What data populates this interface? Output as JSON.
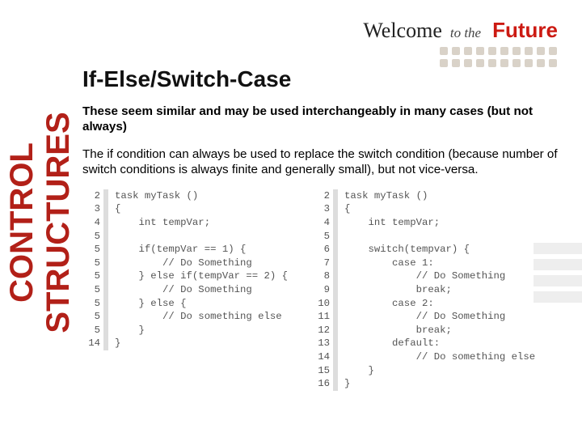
{
  "vertical_label": "CONTROL STRUCTURES",
  "header": {
    "welcome": "Welcome",
    "to_the": "to the",
    "future": "Future"
  },
  "title": "If-Else/Switch-Case",
  "para1": "These seem similar and may be used interchangeably in many cases (but not always)",
  "para2": "The if condition can always be used to replace the switch condition (because number of switch conditions is always finite and generally small), but not vice-versa.",
  "code_left": {
    "lines": [
      {
        "n": "2",
        "t": "task myTask ()"
      },
      {
        "n": "3",
        "t": "{"
      },
      {
        "n": "4",
        "t": "    int tempVar;"
      },
      {
        "n": "5",
        "t": ""
      },
      {
        "n": "5",
        "t": "    if(tempVar == 1) {"
      },
      {
        "n": "5",
        "t": "        // Do Something"
      },
      {
        "n": "5",
        "t": "    } else if(tempVar == 2) {"
      },
      {
        "n": "5",
        "t": "        // Do Something"
      },
      {
        "n": "5",
        "t": "    } else {"
      },
      {
        "n": "5",
        "t": "        // Do something else"
      },
      {
        "n": "5",
        "t": "    }"
      },
      {
        "n": "14",
        "t": "}"
      }
    ]
  },
  "code_right": {
    "lines": [
      {
        "n": "2",
        "t": "task myTask ()"
      },
      {
        "n": "3",
        "t": "{"
      },
      {
        "n": "4",
        "t": "    int tempVar;"
      },
      {
        "n": "5",
        "t": ""
      },
      {
        "n": "6",
        "t": "    switch(tempvar) {"
      },
      {
        "n": "7",
        "t": "        case 1:"
      },
      {
        "n": "8",
        "t": "            // Do Something"
      },
      {
        "n": "9",
        "t": "            break;"
      },
      {
        "n": "10",
        "t": "        case 2:"
      },
      {
        "n": "11",
        "t": "            // Do Something"
      },
      {
        "n": "12",
        "t": "            break;"
      },
      {
        "n": "13",
        "t": "        default:"
      },
      {
        "n": "14",
        "t": "            // Do something else"
      },
      {
        "n": "15",
        "t": "    }"
      },
      {
        "n": "16",
        "t": "}"
      }
    ]
  }
}
